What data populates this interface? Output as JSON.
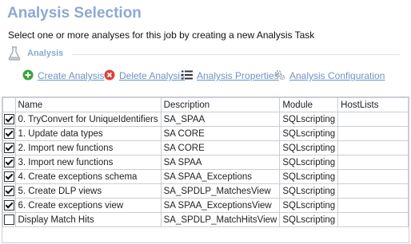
{
  "header": {
    "title": "Analysis Selection",
    "subtitle": "Select one or more analyses for this job by creating a new Analysis Task"
  },
  "section": {
    "label": "Analysis",
    "icon": "flask-icon"
  },
  "toolbar": {
    "create_label": "Create Analysis",
    "delete_label": "Delete Analysis",
    "properties_label": "Analysis Properties",
    "configuration_label": "Analysis Configuration"
  },
  "grid": {
    "columns": [
      "Name",
      "Description",
      "Module",
      "HostLists"
    ],
    "rows": [
      {
        "checked": true,
        "name": "0. TryConvert for UniqueIdentifiers",
        "description": "SA_SPAA",
        "module": "SQLscripting",
        "hostlists": ""
      },
      {
        "checked": true,
        "name": "1. Update data types",
        "description": "SA CORE",
        "module": "SQLscripting",
        "hostlists": ""
      },
      {
        "checked": true,
        "name": "2. Import new functions",
        "description": "SA CORE",
        "module": "SQLscripting",
        "hostlists": ""
      },
      {
        "checked": true,
        "name": "3. Import new functions",
        "description": "SA SPAA",
        "module": "SQLscripting",
        "hostlists": ""
      },
      {
        "checked": true,
        "name": "4. Create exceptions schema",
        "description": "SA SPAA_Exceptions",
        "module": "SQLscripting",
        "hostlists": ""
      },
      {
        "checked": true,
        "name": "5. Create DLP views",
        "description": "SA_SPDLP_MatchesView",
        "module": "SQLscripting",
        "hostlists": ""
      },
      {
        "checked": true,
        "name": "6. Create exceptions view",
        "description": "SA SPAA_ExceptionsView",
        "module": "SQLscripting",
        "hostlists": ""
      },
      {
        "checked": false,
        "name": "Display Match Hits",
        "description": "SA_SPDLP_MatchHitsView",
        "module": "SQLscripting",
        "hostlists": ""
      }
    ]
  },
  "colors": {
    "title": "#8ca9d3",
    "link": "#6f93c5",
    "create_icon": "#3aa53a",
    "delete_icon": "#d9433a",
    "grid_border": "#c9ced4"
  }
}
